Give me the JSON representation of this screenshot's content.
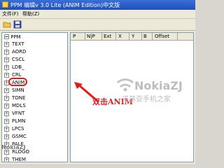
{
  "window": {
    "title": "PPM 编辑v 3.0 Lite (ANIM Edition)中文版"
  },
  "menu": [
    {
      "label": "文件(F)"
    },
    {
      "label": "帮助(Z)"
    }
  ],
  "toolbar": {
    "open_icon": "folder-open-icon",
    "save_icon": "floppy-save-icon"
  },
  "tree": {
    "root": "PPM",
    "items": [
      "TEXT",
      "AORD",
      "CSCL",
      "LDB_",
      "CRL",
      "ANIM",
      "SIMN",
      "TONE",
      "MDLS",
      "VFNT",
      "PLMN",
      "LPCS",
      "GSMC",
      "PALE",
      "RLOGO",
      "THEM"
    ]
  },
  "grid": {
    "columns": [
      "P",
      "N|P",
      "Ext",
      "X",
      "Y",
      "B",
      "Offset"
    ]
  },
  "annotation": {
    "text": "双击ANIM"
  },
  "watermark": {
    "text": "NokiaZJ",
    "subtext": "诺基亚手机之家"
  },
  "watermark2": {
    "text": "NokiaZJ"
  }
}
